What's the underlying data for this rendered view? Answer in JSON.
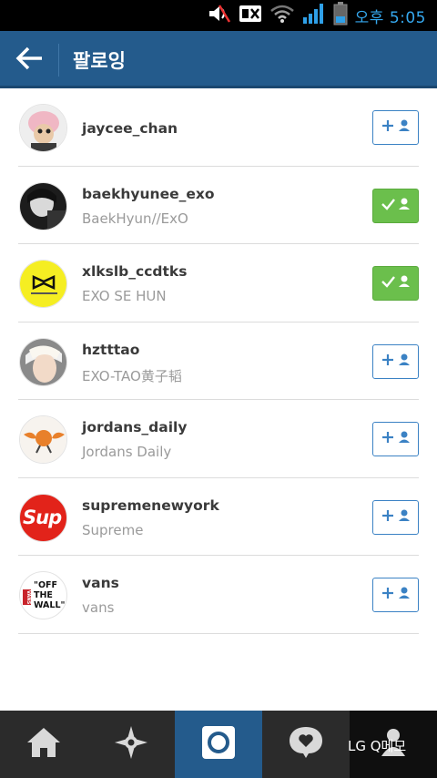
{
  "status_bar": {
    "time": "오후 5:05",
    "icons": [
      "volume-icon",
      "no-sim-icon",
      "wifi-icon",
      "signal-icon",
      "battery-icon"
    ]
  },
  "header": {
    "title": "팔로잉"
  },
  "users": [
    {
      "username": "jaycee_chan",
      "fullname": "",
      "following": false,
      "avatar_color": "#f2c9c9"
    },
    {
      "username": "baekhyunee_exo",
      "fullname": "BaekHyun//ExO",
      "following": true,
      "avatar_color": "#2a2a2a"
    },
    {
      "username": "xlkslb_ccdtks",
      "fullname": "EXO SE HUN",
      "following": true,
      "avatar_color": "#f5ee22"
    },
    {
      "username": "hztttao",
      "fullname": "EXO-TAO黄子韬",
      "following": false,
      "avatar_color": "#d9d4cf"
    },
    {
      "username": "jordans_daily",
      "fullname": "Jordans Daily",
      "following": false,
      "avatar_color": "#f7f3ee"
    },
    {
      "username": "supremenewyork",
      "fullname": "Supreme",
      "following": false,
      "avatar_color": "#e2231a"
    },
    {
      "username": "vans",
      "fullname": "vans",
      "following": false,
      "avatar_color": "#ffffff"
    }
  ],
  "avatar_text": {
    "supreme": "Sup",
    "vans_line1": "\"OFF",
    "vans_line2": "THE",
    "vans_line3": "WALL\"",
    "vans_side": "VANS"
  },
  "bottom_nav": {
    "items": [
      "home-icon",
      "explore-icon",
      "camera-icon",
      "activity-icon",
      "profile-icon"
    ],
    "overlay_label": "LG Q메모"
  },
  "colors": {
    "header": "#245b8c",
    "follow_outline": "#3b82c4",
    "following_fill": "#6bbf4c"
  }
}
